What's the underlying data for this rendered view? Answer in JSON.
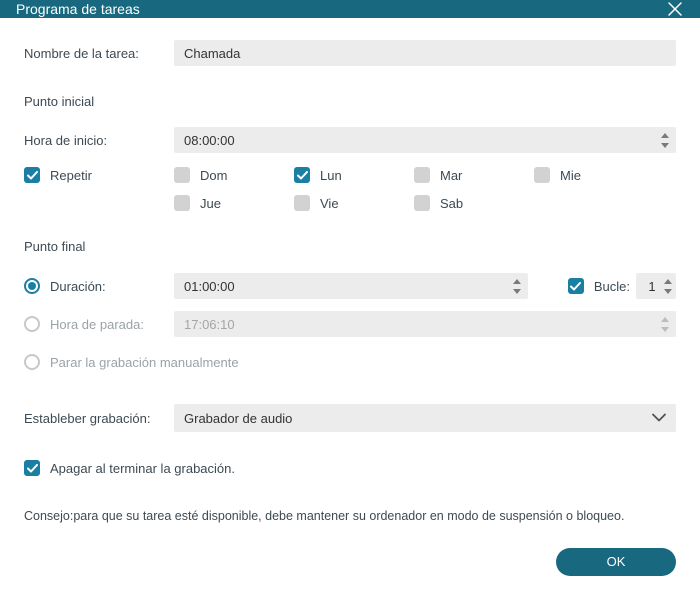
{
  "window": {
    "title": "Programa de tareas"
  },
  "labels": {
    "task_name": "Nombre de la tarea:",
    "start_point": "Punto inicial",
    "start_time": "Hora de inicio:",
    "repeat": "Repetir",
    "end_point": "Punto final",
    "duration": "Duración:",
    "stop_time": "Hora de parada:",
    "stop_manual": "Parar la grabación manualmente",
    "loop": "Bucle:",
    "set_recording": "Estableber grabación:",
    "shutdown": "Apagar al terminar la grabación.",
    "tip": "Consejo:para que su tarea esté disponible, debe mantener su ordenador en modo de suspensión o bloqueo.",
    "ok": "OK"
  },
  "values": {
    "task_name": "Chamada",
    "start_time": "08:00:00",
    "duration": "01:00:00",
    "stop_time": "17:06:10",
    "loop": "1",
    "recording_mode": "Grabador de audio"
  },
  "days": [
    {
      "key": "sun",
      "label": "Dom",
      "checked": false
    },
    {
      "key": "mon",
      "label": "Lun",
      "checked": true
    },
    {
      "key": "tue",
      "label": "Mar",
      "checked": false
    },
    {
      "key": "wed",
      "label": "Mie",
      "checked": false
    },
    {
      "key": "thu",
      "label": "Jue",
      "checked": false
    },
    {
      "key": "fri",
      "label": "Vie",
      "checked": false
    },
    {
      "key": "sat",
      "label": "Sab",
      "checked": false
    }
  ],
  "state": {
    "repeat_checked": true,
    "end_mode": "duration",
    "loop_checked": true,
    "shutdown_checked": true
  }
}
